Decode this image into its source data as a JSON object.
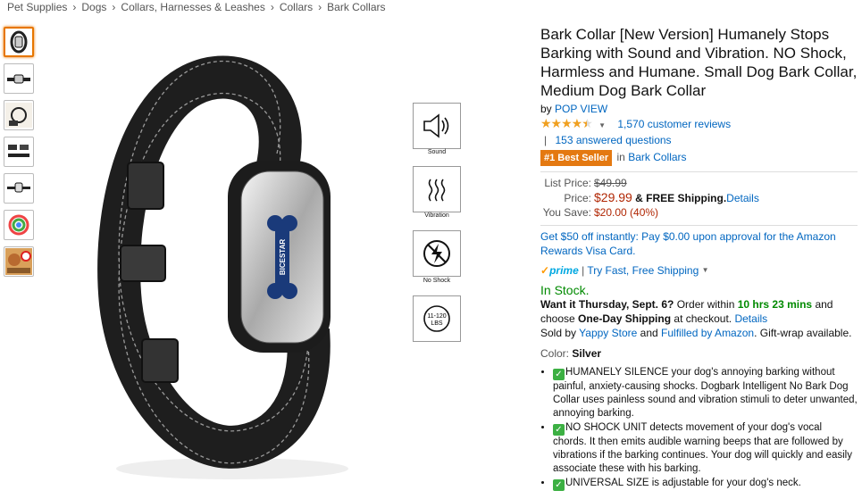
{
  "breadcrumbs": [
    "Pet Supplies",
    "Dogs",
    "Collars, Harnesses & Leashes",
    "Collars",
    "Bark Collars"
  ],
  "breadcrumb_sep": "›",
  "features": [
    {
      "label": "Sound",
      "icon": "speaker-icon"
    },
    {
      "label": "Vibration",
      "icon": "vibration-icon"
    },
    {
      "label": "No Shock",
      "icon": "no-shock-icon"
    },
    {
      "label": "11-120 LBS",
      "icon": "weight-range-icon"
    }
  ],
  "weight_icon_text": [
    "11-120",
    "LBS"
  ],
  "brand_mark": "BICESTAR",
  "product": {
    "title": "Bark Collar [New Version] Humanely Stops Barking with Sound and Vibration. NO Shock, Harmless and Humane. Small Dog Bark Collar, Medium Dog Bark Collar",
    "by": "by",
    "brand": "POP VIEW",
    "rating": 4.5,
    "review_count": "1,570 customer reviews",
    "questions": "153 answered questions",
    "pipe": "|",
    "best_seller": "#1 Best Seller",
    "best_seller_in": "in",
    "best_seller_cat": "Bark Collars"
  },
  "pricing": {
    "list_label": "List Price:",
    "list_price": "$49.99",
    "price_label": "Price:",
    "price": "$29.99",
    "shipping": "& FREE Shipping.",
    "details": "Details",
    "save_label": "You Save:",
    "save": "$20.00 (40%)"
  },
  "promo": "Get $50 off instantly: Pay $0.00 upon approval for the Amazon Rewards Visa Card.",
  "prime": {
    "logo": "prime",
    "pipe": "|",
    "link": "Try Fast, Free Shipping"
  },
  "stock": "In Stock.",
  "delivery": {
    "want_it": "Want it Thursday, Sept. 6?",
    "order_within": "Order within",
    "time": "10 hrs 23 mins",
    "and": "and",
    "choose": "choose",
    "one_day": "One-Day Shipping",
    "at_checkout": "at checkout.",
    "details": "Details",
    "sold_by": "Sold by",
    "seller": "Yappy Store",
    "and2": "and",
    "fulfilled": "Fulfilled by Amazon",
    "giftwrap": ". Gift-wrap available."
  },
  "color": {
    "label": "Color:",
    "value": "Silver"
  },
  "bullets": [
    "HUMANELY SILENCE your dog's annoying barking without painful, anxiety-causing shocks. Dogbark Intelligent No Bark Dog Collar uses painless sound and vibration stimuli to deter unwanted, annoying barking.",
    "NO SHOCK UNIT detects movement of your dog's vocal chords. It then emits audible warning beeps that are followed by vibrations if the barking continues. Your dog will quickly and easily associate these with his barking.",
    "UNIVERSAL SIZE is adjustable for your dog's neck."
  ],
  "colors": {
    "link": "#0066c0",
    "price": "#b12704",
    "badge": "#e47911",
    "stock": "#008a00",
    "selected_thumb": "#e77600"
  }
}
